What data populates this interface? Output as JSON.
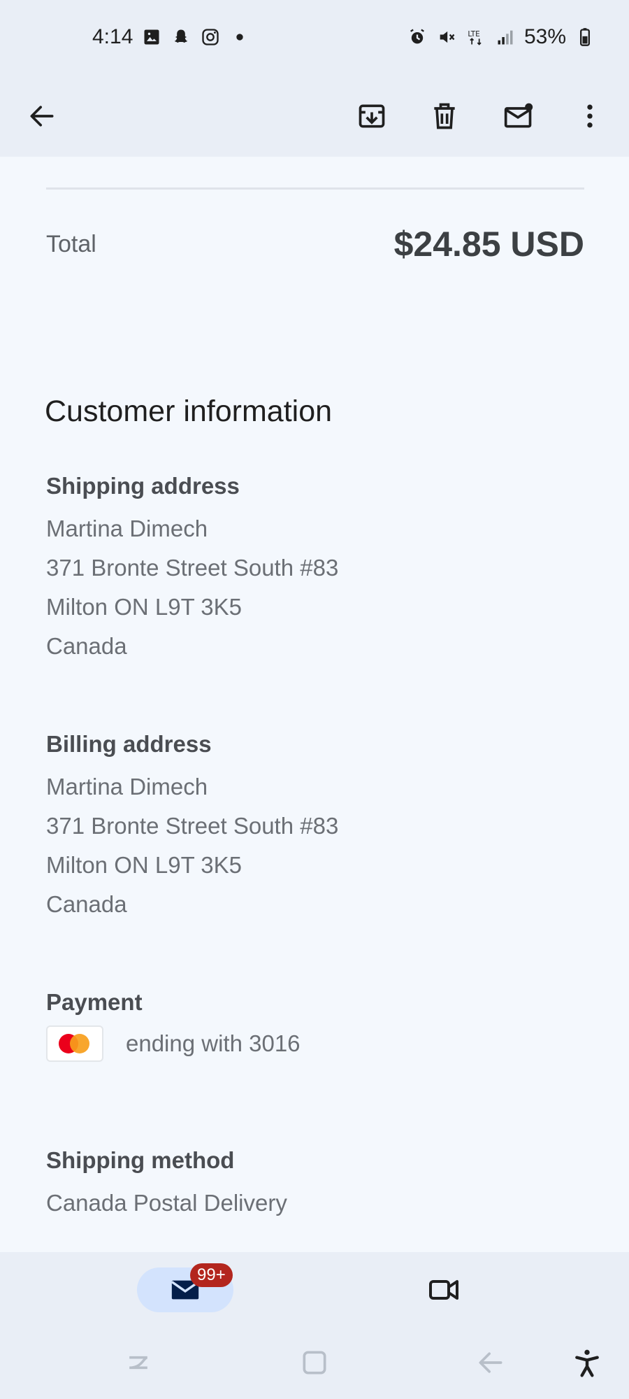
{
  "status_bar": {
    "time": "4:14",
    "battery": "53%",
    "network": "LTE",
    "left_icons": [
      "gallery-icon",
      "snapchat-icon",
      "instagram-icon",
      "dot-icon"
    ],
    "right_icons": [
      "alarm-icon",
      "mute-icon",
      "lte-icon",
      "signal-icon",
      "battery-icon"
    ]
  },
  "app_bar": {
    "actions": [
      "back-arrow-icon",
      "archive-icon",
      "delete-icon",
      "mark-unread-icon",
      "more-vert-icon"
    ]
  },
  "order": {
    "total_label": "Total",
    "total_value": "$24.85 USD"
  },
  "customer": {
    "title": "Customer information",
    "shipping": {
      "heading": "Shipping address",
      "lines": [
        "Martina Dimech",
        "371 Bronte Street South #83",
        "Milton ON L9T 3K5",
        "Canada"
      ]
    },
    "billing": {
      "heading": "Billing address",
      "lines": [
        "Martina Dimech",
        "371 Bronte Street South #83",
        "Milton ON L9T 3K5",
        "Canada"
      ]
    },
    "payment": {
      "heading": "Payment",
      "card_icon": "mastercard-icon",
      "text": "ending with 3016"
    },
    "shipping_method": {
      "heading": "Shipping method",
      "value": "Canada Postal Delivery"
    }
  },
  "bottom_nav": {
    "mail_badge": "99+",
    "tabs": [
      "mail-icon",
      "video-icon"
    ]
  },
  "colors": {
    "background": "#f4f8fd",
    "bar": "#e9eef6",
    "active_tab": "#d3e3fd",
    "badge": "#b3261e"
  }
}
